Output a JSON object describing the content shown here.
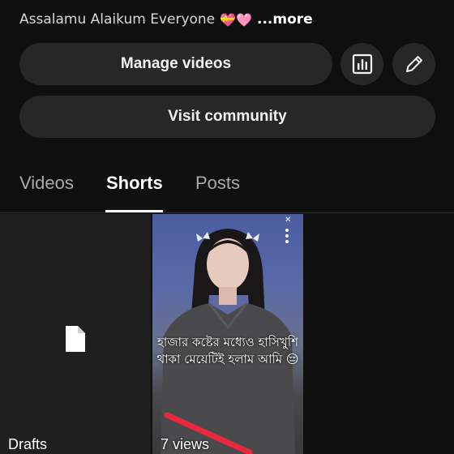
{
  "channel": {
    "description": "Assalamu Alaikum Everyone",
    "description_emoji": "💝🩷",
    "more_label": "...more"
  },
  "actions": {
    "manage_videos": "Manage videos",
    "visit_community": "Visit community",
    "analytics_icon": "analytics-icon",
    "edit_icon": "pencil-icon"
  },
  "tabs": [
    {
      "label": "Videos",
      "active": false
    },
    {
      "label": "Shorts",
      "active": true
    },
    {
      "label": "Posts",
      "active": false
    }
  ],
  "grid": {
    "drafts_label": "Drafts",
    "drafts_icon": "document-icon",
    "short": {
      "overlay_text": "হাজার কষ্টের মধ্যেও হাসিখুশি থাকা মেয়েটিই হলাম আমি 😔",
      "views": "7 views"
    }
  }
}
